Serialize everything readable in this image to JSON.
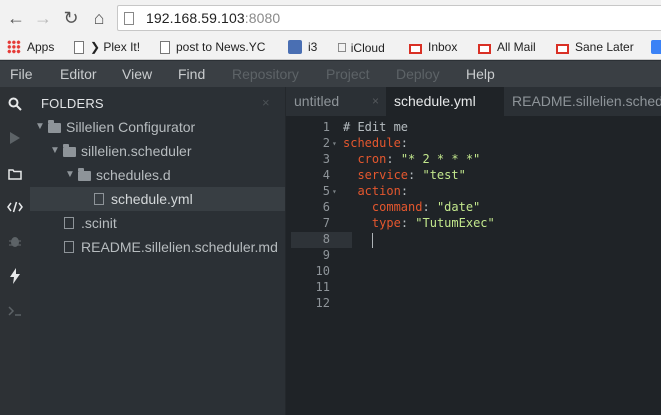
{
  "browser": {
    "url_host": "192.168.59.103",
    "url_port": ":8080",
    "bookmarks": [
      {
        "label": "Apps",
        "icon": "apps-grid-icon"
      },
      {
        "label": "❯ Plex It!",
        "icon": "page-icon"
      },
      {
        "label": "post to News.YC",
        "icon": "page-icon"
      },
      {
        "label": "i3",
        "icon": "i3-icon"
      },
      {
        "label": "iCloud",
        "icon": "apple-icon"
      },
      {
        "label": "Inbox",
        "icon": "gmail-icon"
      },
      {
        "label": "All Mail",
        "icon": "gmail-icon"
      },
      {
        "label": "Sane Later",
        "icon": "gmail-icon"
      }
    ]
  },
  "menu": {
    "items": [
      {
        "label": "File",
        "enabled": true
      },
      {
        "label": "Editor",
        "enabled": true
      },
      {
        "label": "View",
        "enabled": true
      },
      {
        "label": "Find",
        "enabled": true
      },
      {
        "label": "Repository",
        "enabled": false
      },
      {
        "label": "Project",
        "enabled": false
      },
      {
        "label": "Deploy",
        "enabled": false
      },
      {
        "label": "Help",
        "enabled": true
      }
    ]
  },
  "activity_bar": {
    "icons": [
      "search-icon",
      "run-icon",
      "files-icon",
      "code-icon",
      "debug-icon",
      "power-icon",
      "terminal-icon"
    ]
  },
  "sidebar": {
    "header": "FOLDERS",
    "close": "×",
    "tree": [
      {
        "label": "Sillelien Configurator",
        "type": "folder",
        "expanded": true
      },
      {
        "label": "sillelien.scheduler",
        "type": "folder",
        "expanded": true
      },
      {
        "label": "schedules.d",
        "type": "folder",
        "expanded": true
      },
      {
        "label": "schedule.yml",
        "type": "file",
        "selected": true
      },
      {
        "label": ".scinit",
        "type": "file"
      },
      {
        "label": "README.sillelien.scheduler.md",
        "type": "file"
      }
    ]
  },
  "tabs": [
    {
      "label": "untitled",
      "active": false
    },
    {
      "label": "schedule.yml",
      "active": true
    },
    {
      "label": "README.sillelien.scheduler.md",
      "active": false
    }
  ],
  "tab_close": "×",
  "editor": {
    "current_line": 8,
    "lines": [
      {
        "num": "1",
        "fold": "",
        "indent": "",
        "parts": [
          {
            "t": "# Edit me",
            "c": "comment"
          }
        ]
      },
      {
        "num": "2",
        "fold": "▾",
        "indent": "",
        "parts": [
          {
            "t": "schedule",
            "c": "key"
          },
          {
            "t": ":",
            "c": "punc"
          }
        ]
      },
      {
        "num": "3",
        "fold": "",
        "indent": "  ",
        "parts": [
          {
            "t": "cron",
            "c": "key"
          },
          {
            "t": ": ",
            "c": "punc"
          },
          {
            "t": "\"* 2 * * *\"",
            "c": "str"
          }
        ]
      },
      {
        "num": "4",
        "fold": "",
        "indent": "  ",
        "parts": [
          {
            "t": "service",
            "c": "key"
          },
          {
            "t": ": ",
            "c": "punc"
          },
          {
            "t": "\"test\"",
            "c": "str"
          }
        ]
      },
      {
        "num": "5",
        "fold": "▾",
        "indent": "  ",
        "parts": [
          {
            "t": "action",
            "c": "key"
          },
          {
            "t": ":",
            "c": "punc"
          }
        ]
      },
      {
        "num": "6",
        "fold": "",
        "indent": "    ",
        "parts": [
          {
            "t": "command",
            "c": "key"
          },
          {
            "t": ": ",
            "c": "punc"
          },
          {
            "t": "\"date\"",
            "c": "str"
          }
        ]
      },
      {
        "num": "7",
        "fold": "",
        "indent": "    ",
        "parts": [
          {
            "t": "type",
            "c": "key"
          },
          {
            "t": ": ",
            "c": "punc"
          },
          {
            "t": "\"TutumExec\"",
            "c": "str"
          }
        ]
      },
      {
        "num": "8",
        "fold": "",
        "indent": "",
        "parts": []
      },
      {
        "num": "9",
        "fold": "",
        "indent": "",
        "parts": []
      },
      {
        "num": "10",
        "fold": "",
        "indent": "",
        "parts": []
      },
      {
        "num": "11",
        "fold": "",
        "indent": "",
        "parts": []
      },
      {
        "num": "12",
        "fold": "",
        "indent": "",
        "parts": []
      }
    ]
  },
  "colors": {
    "accent_key": "#e4572e",
    "string": "#c3e88d",
    "editor_bg": "#1f2327",
    "sidebar_bg": "#2b3035"
  }
}
